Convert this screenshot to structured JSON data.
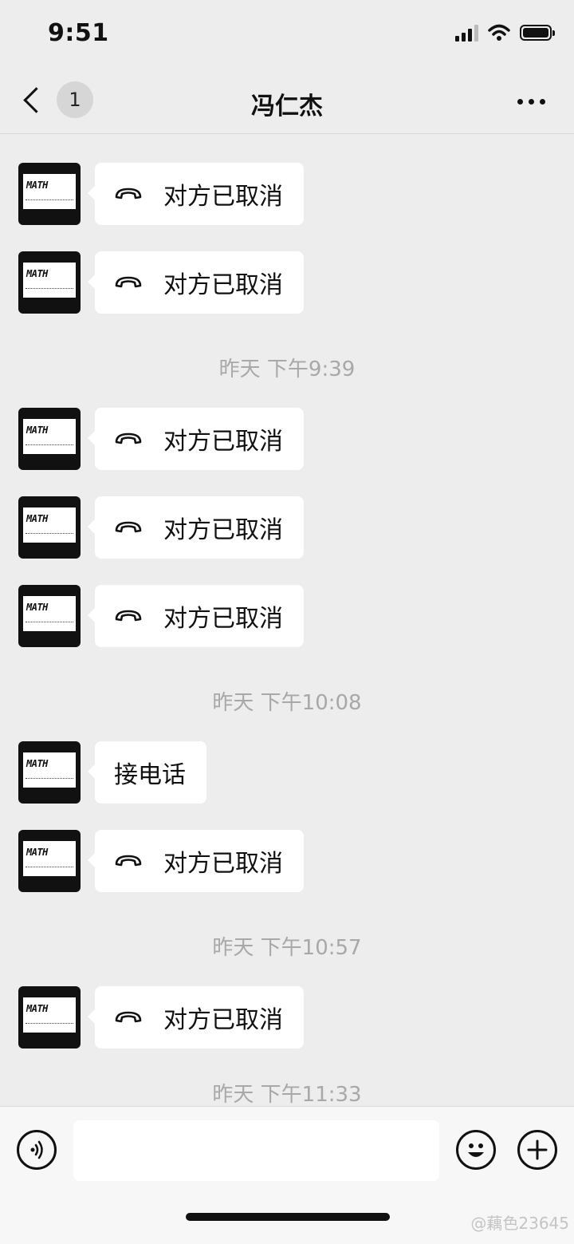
{
  "status_bar": {
    "time": "9:51"
  },
  "nav": {
    "unread_count": "1",
    "title": "冯仁杰"
  },
  "thread": {
    "messages": [
      {
        "type": "call",
        "text": "对方已取消"
      },
      {
        "type": "call",
        "text": "对方已取消"
      },
      {
        "type": "time",
        "text": "昨天 下午9:39"
      },
      {
        "type": "call",
        "text": "对方已取消"
      },
      {
        "type": "call",
        "text": "对方已取消"
      },
      {
        "type": "call",
        "text": "对方已取消"
      },
      {
        "type": "time",
        "text": "昨天 下午10:08"
      },
      {
        "type": "text",
        "text": "接电话"
      },
      {
        "type": "call",
        "text": "对方已取消"
      },
      {
        "type": "time",
        "text": "昨天 下午10:57"
      },
      {
        "type": "call",
        "text": "对方已取消"
      },
      {
        "type": "time",
        "text": "昨天 下午11:33"
      }
    ],
    "avatar_logo": "MATH"
  },
  "input_bar": {
    "placeholder": ""
  },
  "watermark": "@藕色23645",
  "icons": {
    "back": "chevron-left-icon",
    "more": "more-dots-icon",
    "call": "phone-hangup-icon",
    "voice": "voice-icon",
    "emoji": "emoji-icon",
    "plus": "plus-icon"
  }
}
